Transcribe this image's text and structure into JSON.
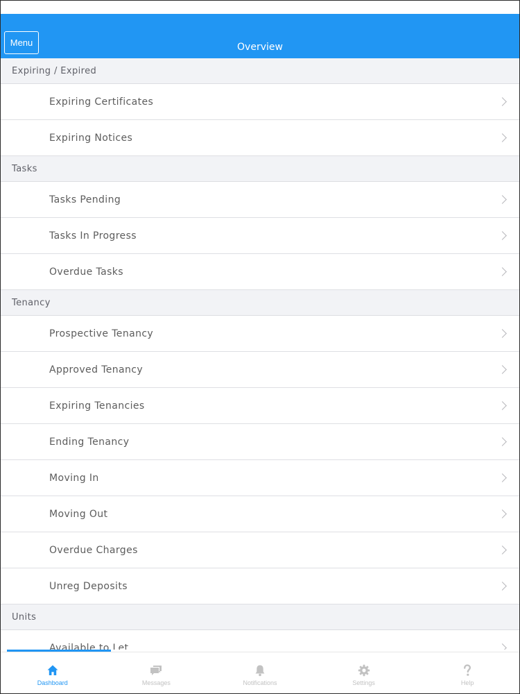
{
  "header": {
    "menu_label": "Menu",
    "title": "Overview"
  },
  "sections": [
    {
      "title": "Expiring / Expired",
      "items": [
        "Expiring Certificates",
        "Expiring Notices"
      ]
    },
    {
      "title": "Tasks",
      "items": [
        "Tasks Pending",
        "Tasks In Progress",
        "Overdue Tasks"
      ]
    },
    {
      "title": "Tenancy",
      "items": [
        "Prospective Tenancy",
        "Approved Tenancy",
        "Expiring Tenancies",
        "Ending Tenancy",
        "Moving In",
        "Moving Out",
        "Overdue Charges",
        "Unreg Deposits"
      ]
    },
    {
      "title": "Units",
      "items": [
        "Available to Let"
      ]
    }
  ],
  "loading_progress": 0.2,
  "tabs": [
    {
      "label": "Dashboard",
      "icon": "home-icon",
      "active": true
    },
    {
      "label": "Messages",
      "icon": "chat-bubbles-icon",
      "active": false
    },
    {
      "label": "Notifications",
      "icon": "bell-icon",
      "active": false
    },
    {
      "label": "Settings",
      "icon": "gear-icon",
      "active": false
    },
    {
      "label": "Help",
      "icon": "question-mark-icon",
      "active": false
    }
  ],
  "colors": {
    "accent": "#2196f3",
    "inactive_tab": "#c2c2c2",
    "section_background": "#f2f3f6"
  }
}
